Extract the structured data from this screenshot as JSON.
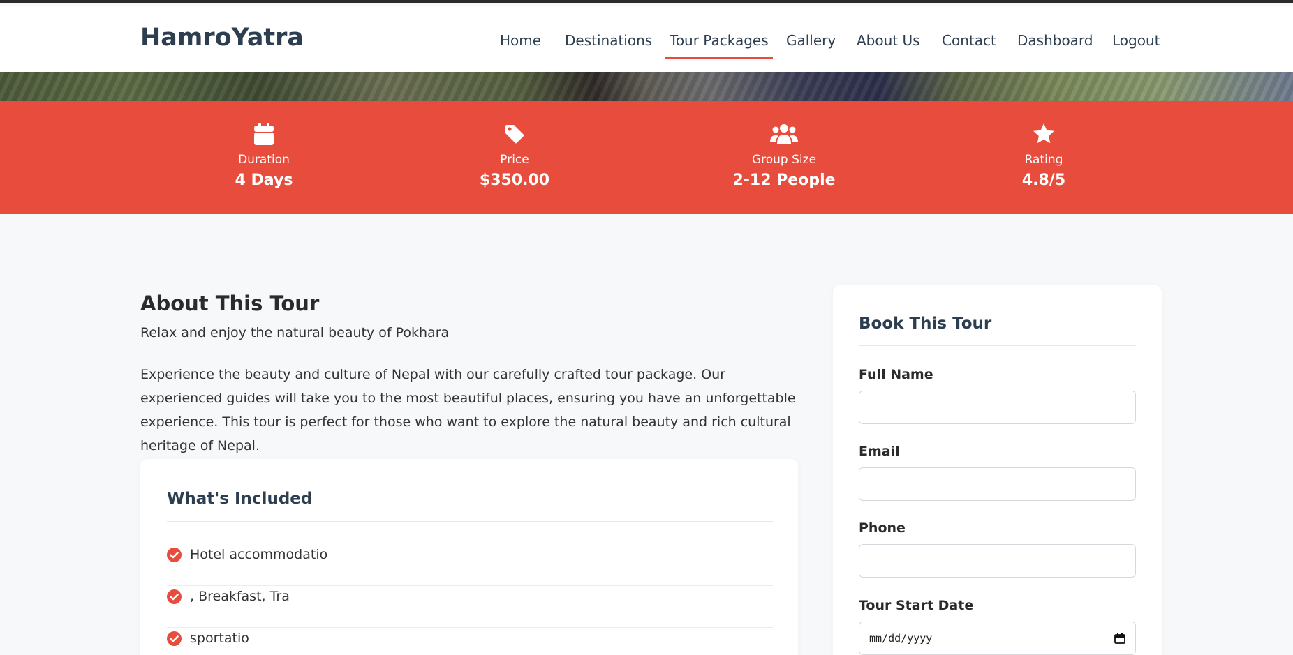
{
  "brand": "HamroYatra",
  "nav": [
    {
      "label": "Home"
    },
    {
      "label": "Destinations"
    },
    {
      "label": "Tour Packages",
      "active": true
    },
    {
      "label": "Gallery"
    },
    {
      "label": "About Us"
    },
    {
      "label": "Contact"
    },
    {
      "label": "Dashboard"
    },
    {
      "label": "Logout"
    }
  ],
  "stats": [
    {
      "icon": "calendar-icon",
      "label": "Duration",
      "value": "4 Days"
    },
    {
      "icon": "price-tag-icon",
      "label": "Price",
      "value": "$350.00"
    },
    {
      "icon": "users-icon",
      "label": "Group Size",
      "value": "2-12 People"
    },
    {
      "icon": "star-icon",
      "label": "Rating",
      "value": "4.8/5"
    }
  ],
  "about": {
    "title": "About This Tour",
    "subtitle": "Relax and enjoy the natural beauty of Pokhara",
    "description": "Experience the beauty and culture of Nepal with our carefully crafted tour package. Our experienced guides will take you to the most beautiful places, ensuring you have an unforgettable experience. This tour is perfect for those who want to explore the natural beauty and rich cultural heritage of Nepal."
  },
  "included": {
    "title": "What's Included",
    "items": [
      "Hotel accommodatio",
      ", Breakfast, Tra",
      "sportatio"
    ]
  },
  "booking": {
    "title": "Book This Tour",
    "fields": [
      {
        "label": "Full Name",
        "value": "",
        "placeholder": ""
      },
      {
        "label": "Email",
        "value": "",
        "placeholder": ""
      },
      {
        "label": "Phone",
        "value": "",
        "placeholder": ""
      },
      {
        "label": "Tour Start Date",
        "value": "mm/dd/yyyy"
      }
    ]
  },
  "colors": {
    "accent": "#e74c3c",
    "heading": "#2c3e50",
    "background": "#f7f8fa"
  }
}
